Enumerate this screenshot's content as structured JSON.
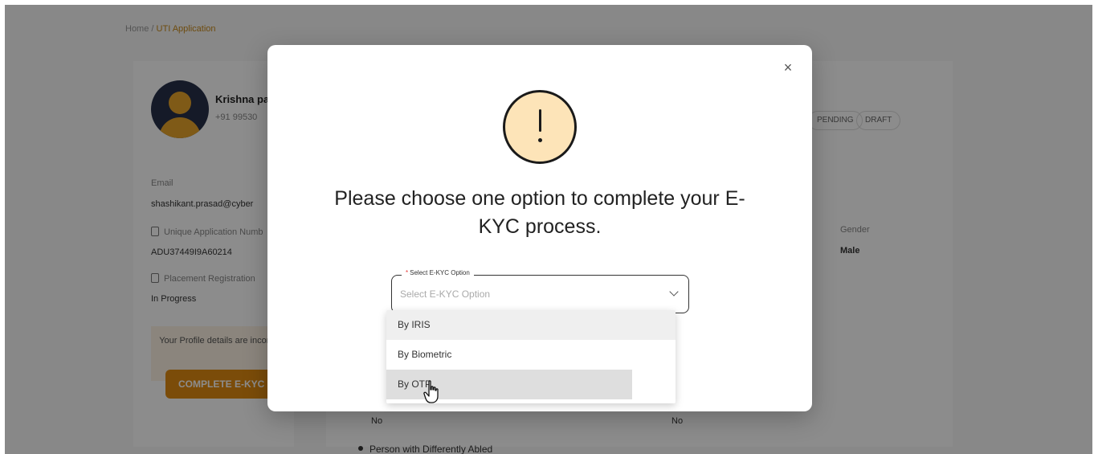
{
  "background": {
    "breadcrumb": {
      "home": "Home",
      "current": "UTI Application"
    },
    "user": {
      "name": "Krishna pa",
      "phone": "+91 99530"
    },
    "fields": [
      {
        "label": "Email",
        "value": "shashikant.prasad@cyber"
      },
      {
        "label": "Unique Application Numb",
        "value": "ADU37449I9A60214"
      },
      {
        "label": "Placement Registration",
        "value": "In Progress"
      }
    ],
    "profile_note": "Your Profile details are incomplete!",
    "complete_button": "COMPLETE E-KYC",
    "pills": [
      "PENDING",
      "DRAFT"
    ],
    "gender": {
      "label": "Gender",
      "value": "Male"
    },
    "no_values": [
      "No",
      "No"
    ],
    "section_item": "Person with Differently Abled"
  },
  "modal": {
    "close_label": "×",
    "title": "Please choose one option to complete your E-KYC process.",
    "select": {
      "label": "Select E-KYC Option",
      "required_mark": "*",
      "placeholder": "Select E-KYC Option"
    },
    "options": [
      "By IRIS",
      "By Biometric",
      "By OTP"
    ],
    "active_option": "By IRIS",
    "hovered_option": "By OTP"
  },
  "colors": {
    "accent": "#e08a12",
    "alert_fill": "#fde4b8",
    "required": "#e53935",
    "overlay": "rgba(0,0,0,0.45)"
  },
  "icons": [
    "close-icon",
    "exclamation-icon",
    "chevron-down-icon",
    "hand-cursor-icon",
    "document-icon",
    "user-icon"
  ]
}
